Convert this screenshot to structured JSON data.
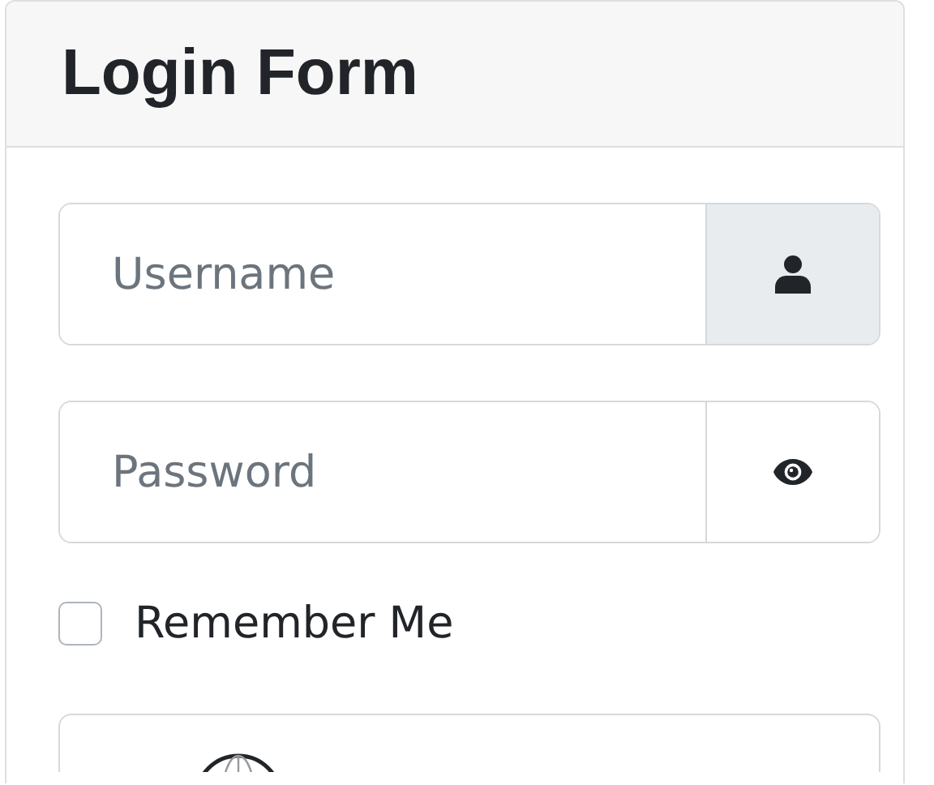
{
  "card": {
    "title": "Login Form"
  },
  "fields": [
    {
      "placeholder": "Username",
      "addon_shaded": true
    },
    {
      "placeholder": "Password",
      "addon_shaded": false
    }
  ],
  "remember": {
    "label": "Remember Me",
    "checked": false
  }
}
